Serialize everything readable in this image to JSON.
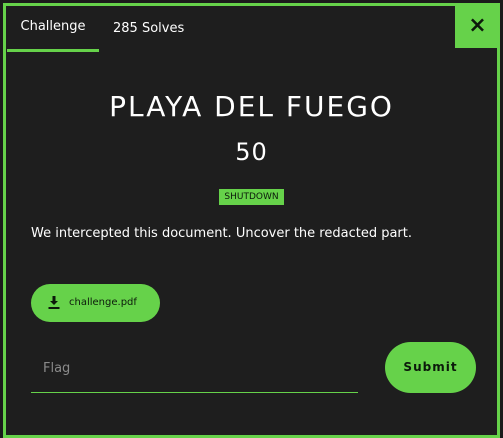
{
  "tabs": [
    {
      "label": "Challenge",
      "active": true
    },
    {
      "label": "285 Solves",
      "active": false
    }
  ],
  "close": {
    "glyph": "×",
    "icon": "close-icon"
  },
  "challenge": {
    "title": "PLAYA DEL FUEGO",
    "points": "50",
    "tag": "SHUTDOWN",
    "description": "We intercepted this document. Uncover the redacted part."
  },
  "file": {
    "label": "challenge.pdf",
    "icon": "download-icon"
  },
  "flag": {
    "placeholder": "Flag",
    "value": ""
  },
  "submit": {
    "label": "Submit"
  },
  "colors": {
    "accent": "#66d24a",
    "background": "#1e1e1e",
    "text": "#ffffff"
  }
}
